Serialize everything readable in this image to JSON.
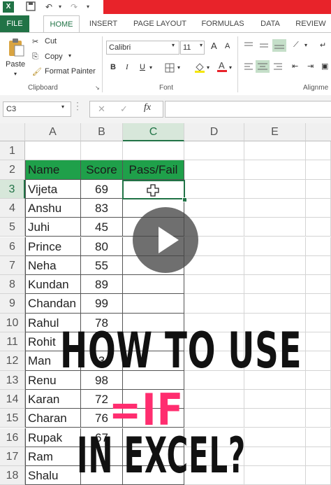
{
  "quick_access": {
    "app_icon": "excel-icon",
    "save_icon": "save-icon",
    "undo_icon": "undo-icon",
    "redo_icon": "redo-icon"
  },
  "tabs": [
    "FILE",
    "HOME",
    "INSERT",
    "PAGE LAYOUT",
    "FORMULAS",
    "DATA",
    "REVIEW"
  ],
  "clipboard": {
    "paste": "Paste",
    "cut": "Cut",
    "copy": "Copy",
    "format_painter": "Format Painter",
    "group": "Clipboard"
  },
  "font": {
    "name": "Calibri",
    "size": "11",
    "bold": "B",
    "italic": "I",
    "underline": "U",
    "group": "Font",
    "grow": "A",
    "shrink": "A"
  },
  "alignment": {
    "group": "Alignme"
  },
  "formula_bar": {
    "name_box": "C3",
    "cancel": "✕",
    "enter": "✓",
    "fx": "fx",
    "formula": ""
  },
  "columns": [
    "A",
    "B",
    "C",
    "D",
    "E"
  ],
  "header_row": {
    "name": "Name",
    "score": "Score",
    "result": "Pass/Fail"
  },
  "rows": [
    {
      "num": "1",
      "name": "",
      "score": ""
    },
    {
      "num": "2",
      "name": "Name",
      "score": "Score"
    },
    {
      "num": "3",
      "name": "Vijeta",
      "score": "69"
    },
    {
      "num": "4",
      "name": "Anshu",
      "score": "83"
    },
    {
      "num": "5",
      "name": "Juhi",
      "score": "45"
    },
    {
      "num": "6",
      "name": "Prince",
      "score": "80"
    },
    {
      "num": "7",
      "name": "Neha",
      "score": "55"
    },
    {
      "num": "8",
      "name": "Kundan",
      "score": "89"
    },
    {
      "num": "9",
      "name": "Chandan",
      "score": "99"
    },
    {
      "num": "10",
      "name": "Rahul",
      "score": "78"
    },
    {
      "num": "11",
      "name": "Rohit",
      "score": ""
    },
    {
      "num": "12",
      "name": "Man",
      "score": "3"
    },
    {
      "num": "13",
      "name": "Renu",
      "score": "98"
    },
    {
      "num": "14",
      "name": "Karan",
      "score": "72"
    },
    {
      "num": "15",
      "name": "Charan",
      "score": "76"
    },
    {
      "num": "16",
      "name": "Rupak",
      "score": "67"
    },
    {
      "num": "17",
      "name": "Ram",
      "score": ""
    },
    {
      "num": "18",
      "name": "Shalu",
      "score": ""
    }
  ],
  "overlay": {
    "line1": "HOW TO USE",
    "line2": "=IF",
    "line3": "IN EXCEL?",
    "line2_color": "#ff2d6f"
  },
  "colors": {
    "excel_green": "#217346",
    "header_fill": "#1fa04a",
    "red_bar": "#e8232a"
  }
}
